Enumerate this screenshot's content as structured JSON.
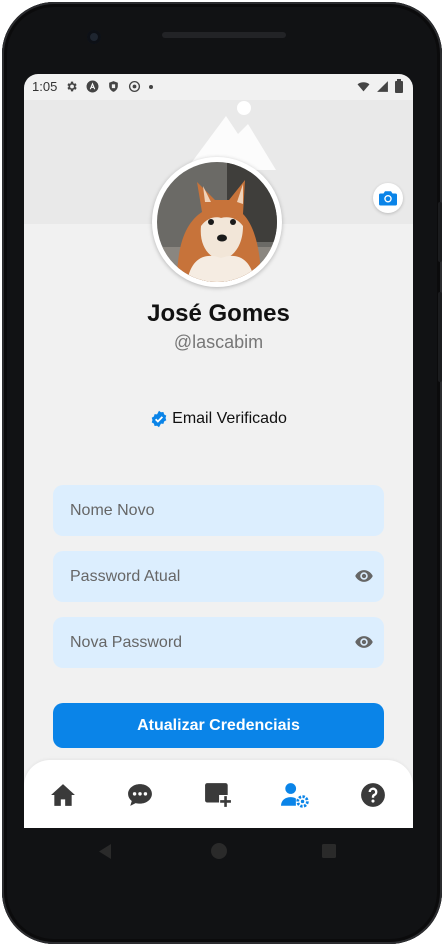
{
  "status_bar": {
    "time": "1:05",
    "icons_left": [
      "settings-icon",
      "notification-a-icon",
      "shield-icon",
      "sync-icon",
      "dot-icon"
    ],
    "icons_right": [
      "wifi-icon",
      "cell-signal-icon",
      "battery-icon"
    ]
  },
  "profile": {
    "name": "José Gomes",
    "handle": "@lascabim",
    "verified_label": "Email Verificado"
  },
  "form": {
    "new_name_placeholder": "Nome Novo",
    "current_password_placeholder": "Password Atual",
    "new_password_placeholder": "Nova Password",
    "submit_label": "Atualizar Credenciais"
  },
  "bottom_nav": {
    "items": [
      "home-icon",
      "chat-icon",
      "add-post-icon",
      "user-settings-icon",
      "help-icon"
    ],
    "active": "user-settings-icon"
  },
  "colors": {
    "accent": "#0a84e8",
    "field_bg": "#dceefe",
    "screen_bg": "#f1f1f1"
  }
}
